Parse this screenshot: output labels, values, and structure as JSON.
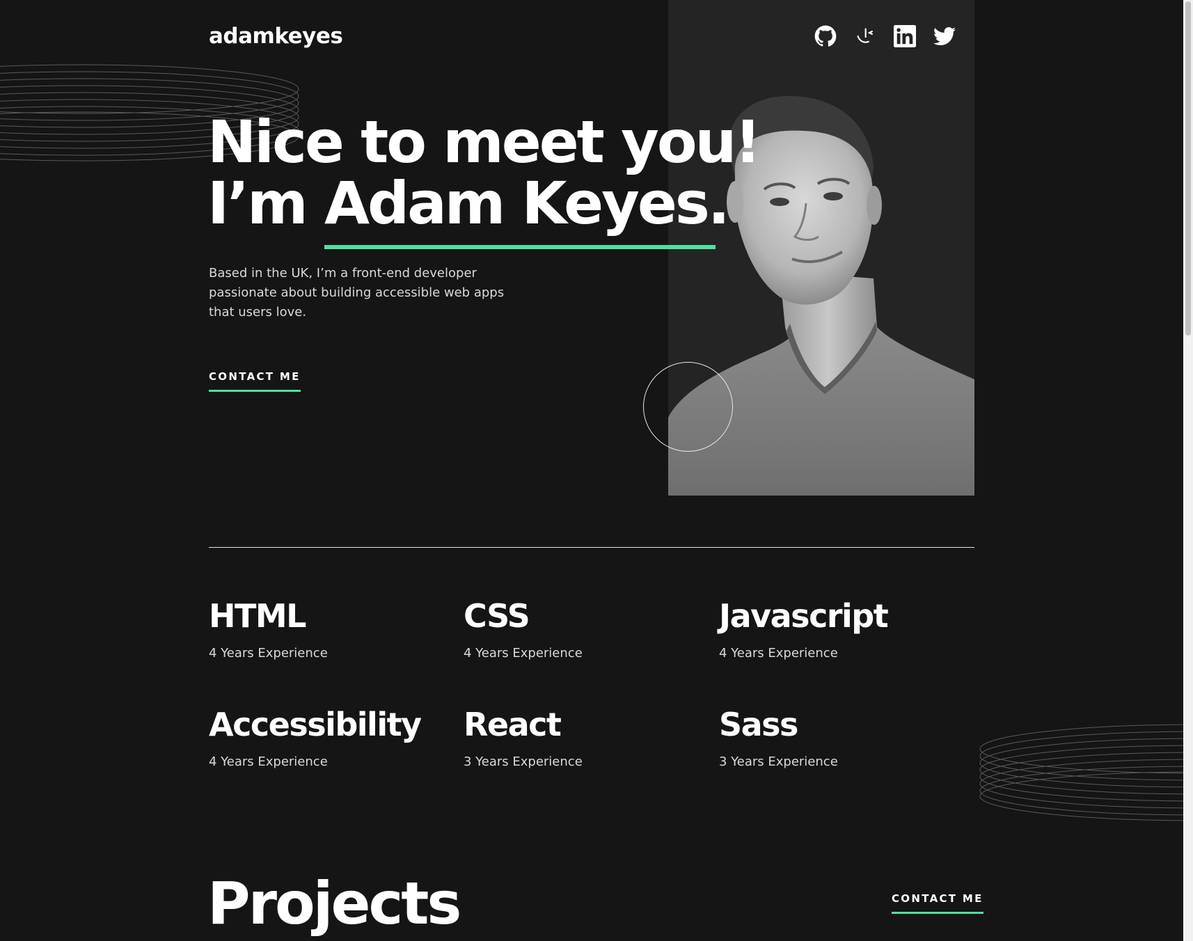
{
  "header": {
    "logo": "adamkeyes",
    "social": [
      {
        "name": "github-icon"
      },
      {
        "name": "frontend-mentor-icon"
      },
      {
        "name": "linkedin-icon"
      },
      {
        "name": "twitter-icon"
      }
    ]
  },
  "hero": {
    "title_line1": "Nice to meet you!",
    "title_prefix": "I’m ",
    "title_name": "Adam Keyes.",
    "description": "Based in the UK, I’m a front-end developer passionate about building accessible web apps that users love.",
    "contact_label": "CONTACT ME",
    "photo_icon": "portrait-photo"
  },
  "skills": [
    {
      "name": "HTML",
      "experience": "4 Years Experience"
    },
    {
      "name": "CSS",
      "experience": "4 Years Experience"
    },
    {
      "name": "Javascript",
      "experience": "4 Years Experience"
    },
    {
      "name": "Accessibility",
      "experience": "4 Years Experience"
    },
    {
      "name": "React",
      "experience": "3 Years Experience"
    },
    {
      "name": "Sass",
      "experience": "3 Years Experience"
    }
  ],
  "projects": {
    "title": "Projects",
    "contact_label": "CONTACT ME"
  },
  "colors": {
    "background": "#151515",
    "accent": "#4ee1a0",
    "text": "#ffffff",
    "muted_text": "#d9d9d9",
    "photo_panel": "#242424"
  }
}
